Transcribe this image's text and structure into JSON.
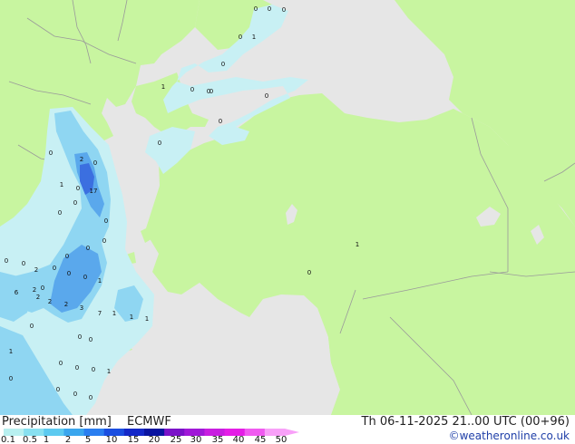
{
  "legend": {
    "title": "Precipitation [mm]",
    "model": "ECMWF",
    "run": "Th 06-11-2025 21..00 UTC (00+96)",
    "credit": "©weatheronline.co.uk",
    "ticks": [
      "0.1",
      "0.5",
      "1",
      "2",
      "5",
      "10",
      "15",
      "20",
      "25",
      "30",
      "35",
      "40",
      "45",
      "50"
    ],
    "colors": [
      "#b8f0f0",
      "#88e0f0",
      "#5ccaf0",
      "#3aa6ee",
      "#2a7ef0",
      "#1a4ee0",
      "#1428c8",
      "#0a14a0",
      "#7a12c8",
      "#a018d8",
      "#c81ee0",
      "#e41ee6",
      "#f05af0",
      "#f8a0f8"
    ]
  },
  "map": {
    "colors": {
      "sea": "#e6e6e6",
      "land": "#c8f5a0",
      "border": "#9a9a9a",
      "precip_light": "#c8f0f4",
      "precip_med": "#8fd6f2",
      "precip_heavy": "#5aa8ec",
      "precip_intense": "#3b6fe0"
    },
    "values": [
      "0",
      "0",
      "0",
      "0",
      "1",
      "1",
      "0",
      "0",
      "0",
      "0",
      "0",
      "0",
      "2",
      "0",
      "1",
      "0",
      "17",
      "0",
      "0",
      "0",
      "0",
      "0",
      "0",
      "0",
      "0",
      "0",
      "2",
      "0",
      "0",
      "0",
      "6",
      "1",
      "2",
      "2",
      "0",
      "2",
      "2",
      "3",
      "7",
      "1",
      "1",
      "1",
      "0",
      "0",
      "0",
      "1",
      "0",
      "0",
      "1",
      "0",
      "0",
      "0",
      "0",
      "0",
      "1",
      "0",
      "0"
    ]
  }
}
